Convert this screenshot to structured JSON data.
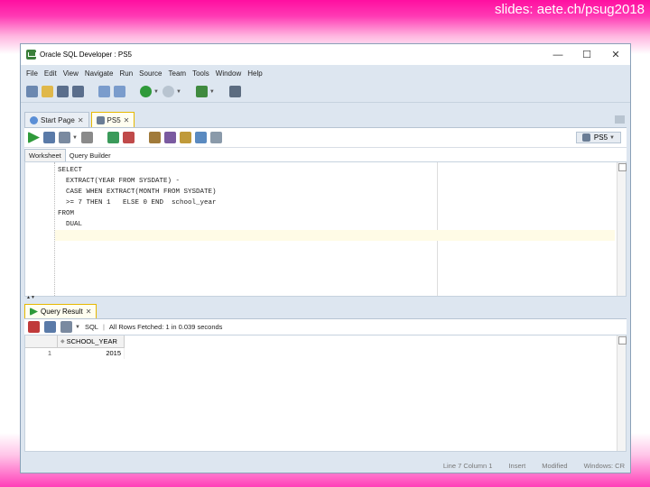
{
  "slide": {
    "caption": "slides: aete.ch/psug2018"
  },
  "window": {
    "title": "Oracle SQL Developer : PS5",
    "minimize": "—",
    "maximize": "☐",
    "close": "✕"
  },
  "menu": [
    "File",
    "Edit",
    "View",
    "Navigate",
    "Run",
    "Source",
    "Team",
    "Tools",
    "Window",
    "Help"
  ],
  "tabs": [
    {
      "label": "Start Page",
      "close": "✕"
    },
    {
      "label": "PS5",
      "close": "✕"
    }
  ],
  "editor": {
    "connection": "PS5",
    "subtabs": [
      "Worksheet",
      "Query Builder"
    ],
    "code": [
      "SELECT",
      "  EXTRACT(YEAR FROM SYSDATE) -",
      "  CASE WHEN EXTRACT(MONTH FROM SYSDATE)",
      "  >= 7 THEN 1   ELSE 0 END  school_year",
      "FROM",
      "  DUAL"
    ]
  },
  "result": {
    "tab_label": "Query Result",
    "sql_label": "SQL",
    "status": "All Rows Fetched: 1 in 0.039 seconds",
    "column": "SCHOOL_YEAR",
    "rows": [
      {
        "num": "1",
        "value": "2015"
      }
    ]
  },
  "statusbar": {
    "position": "Line 7 Column 1",
    "mode": "Insert",
    "modified": "Modified",
    "eol": "Windows: CR"
  },
  "colors": {
    "accent_tab": "#e6b800",
    "window_bg": "#dde6f0"
  }
}
